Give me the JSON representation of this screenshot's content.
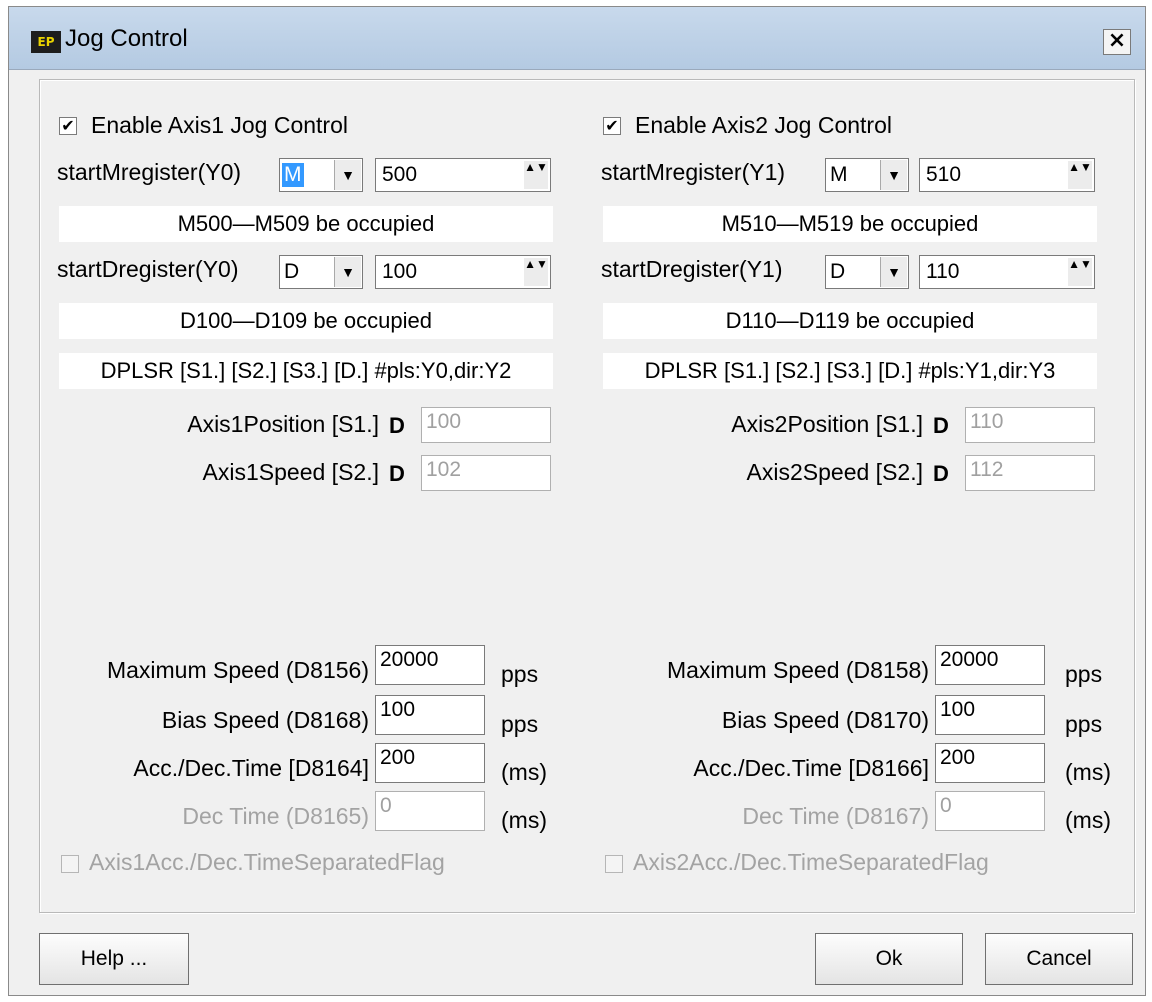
{
  "window": {
    "title": "Jog Control",
    "icon_text": "EP",
    "close_label": "×"
  },
  "axis1": {
    "enable_label": "Enable Axis1 Jog Control",
    "start_m_label": "startMregister(Y0)",
    "m_type": "M",
    "m_value": "500",
    "m_info": "M500—M509 be occupied",
    "start_d_label": "startDregister(Y0)",
    "d_type": "D",
    "d_value": "100",
    "d_info": "D100—D109 be occupied",
    "instruction": "DPLSR [S1.] [S2.] [S3.] [D.] #pls:Y0,dir:Y2",
    "position_label": "Axis1Position [S1.]",
    "position_reg": "D",
    "position_value": "100",
    "speed_label": "Axis1Speed [S2.]",
    "speed_reg": "D",
    "speed_value": "102",
    "max_speed_label": "Maximum Speed (D8156)",
    "max_speed_value": "20000",
    "max_speed_unit": "pps",
    "bias_speed_label": "Bias Speed (D8168)",
    "bias_speed_value": "100",
    "bias_speed_unit": "pps",
    "acc_label": "Acc./Dec.Time [D8164]",
    "acc_value": "200",
    "acc_unit": "(ms)",
    "dec_label": "Dec Time (D8165)",
    "dec_value": "0",
    "dec_unit": "(ms)",
    "separated_label": "Axis1Acc./Dec.TimeSeparatedFlag"
  },
  "axis2": {
    "enable_label": "Enable Axis2 Jog Control",
    "start_m_label": "startMregister(Y1)",
    "m_type": "M",
    "m_value": "510",
    "m_info": "M510—M519 be occupied",
    "start_d_label": "startDregister(Y1)",
    "d_type": "D",
    "d_value": "110",
    "d_info": "D110—D119 be occupied",
    "instruction": "DPLSR [S1.] [S2.] [S3.] [D.] #pls:Y1,dir:Y3",
    "position_label": "Axis2Position [S1.]",
    "position_reg": "D",
    "position_value": "110",
    "speed_label": "Axis2Speed [S2.]",
    "speed_reg": "D",
    "speed_value": "112",
    "max_speed_label": "Maximum Speed (D8158)",
    "max_speed_value": "20000",
    "max_speed_unit": "pps",
    "bias_speed_label": "Bias Speed (D8170)",
    "bias_speed_value": "100",
    "bias_speed_unit": "pps",
    "acc_label": "Acc./Dec.Time [D8166]",
    "acc_value": "200",
    "acc_unit": "(ms)",
    "dec_label": "Dec Time (D8167)",
    "dec_value": "0",
    "dec_unit": "(ms)",
    "separated_label": "Axis2Acc./Dec.TimeSeparatedFlag"
  },
  "buttons": {
    "help": "Help ...",
    "ok": "Ok",
    "cancel": "Cancel"
  },
  "icons": {
    "checkmark": "✔",
    "dropdown": "▼",
    "spin": "▲▼"
  }
}
